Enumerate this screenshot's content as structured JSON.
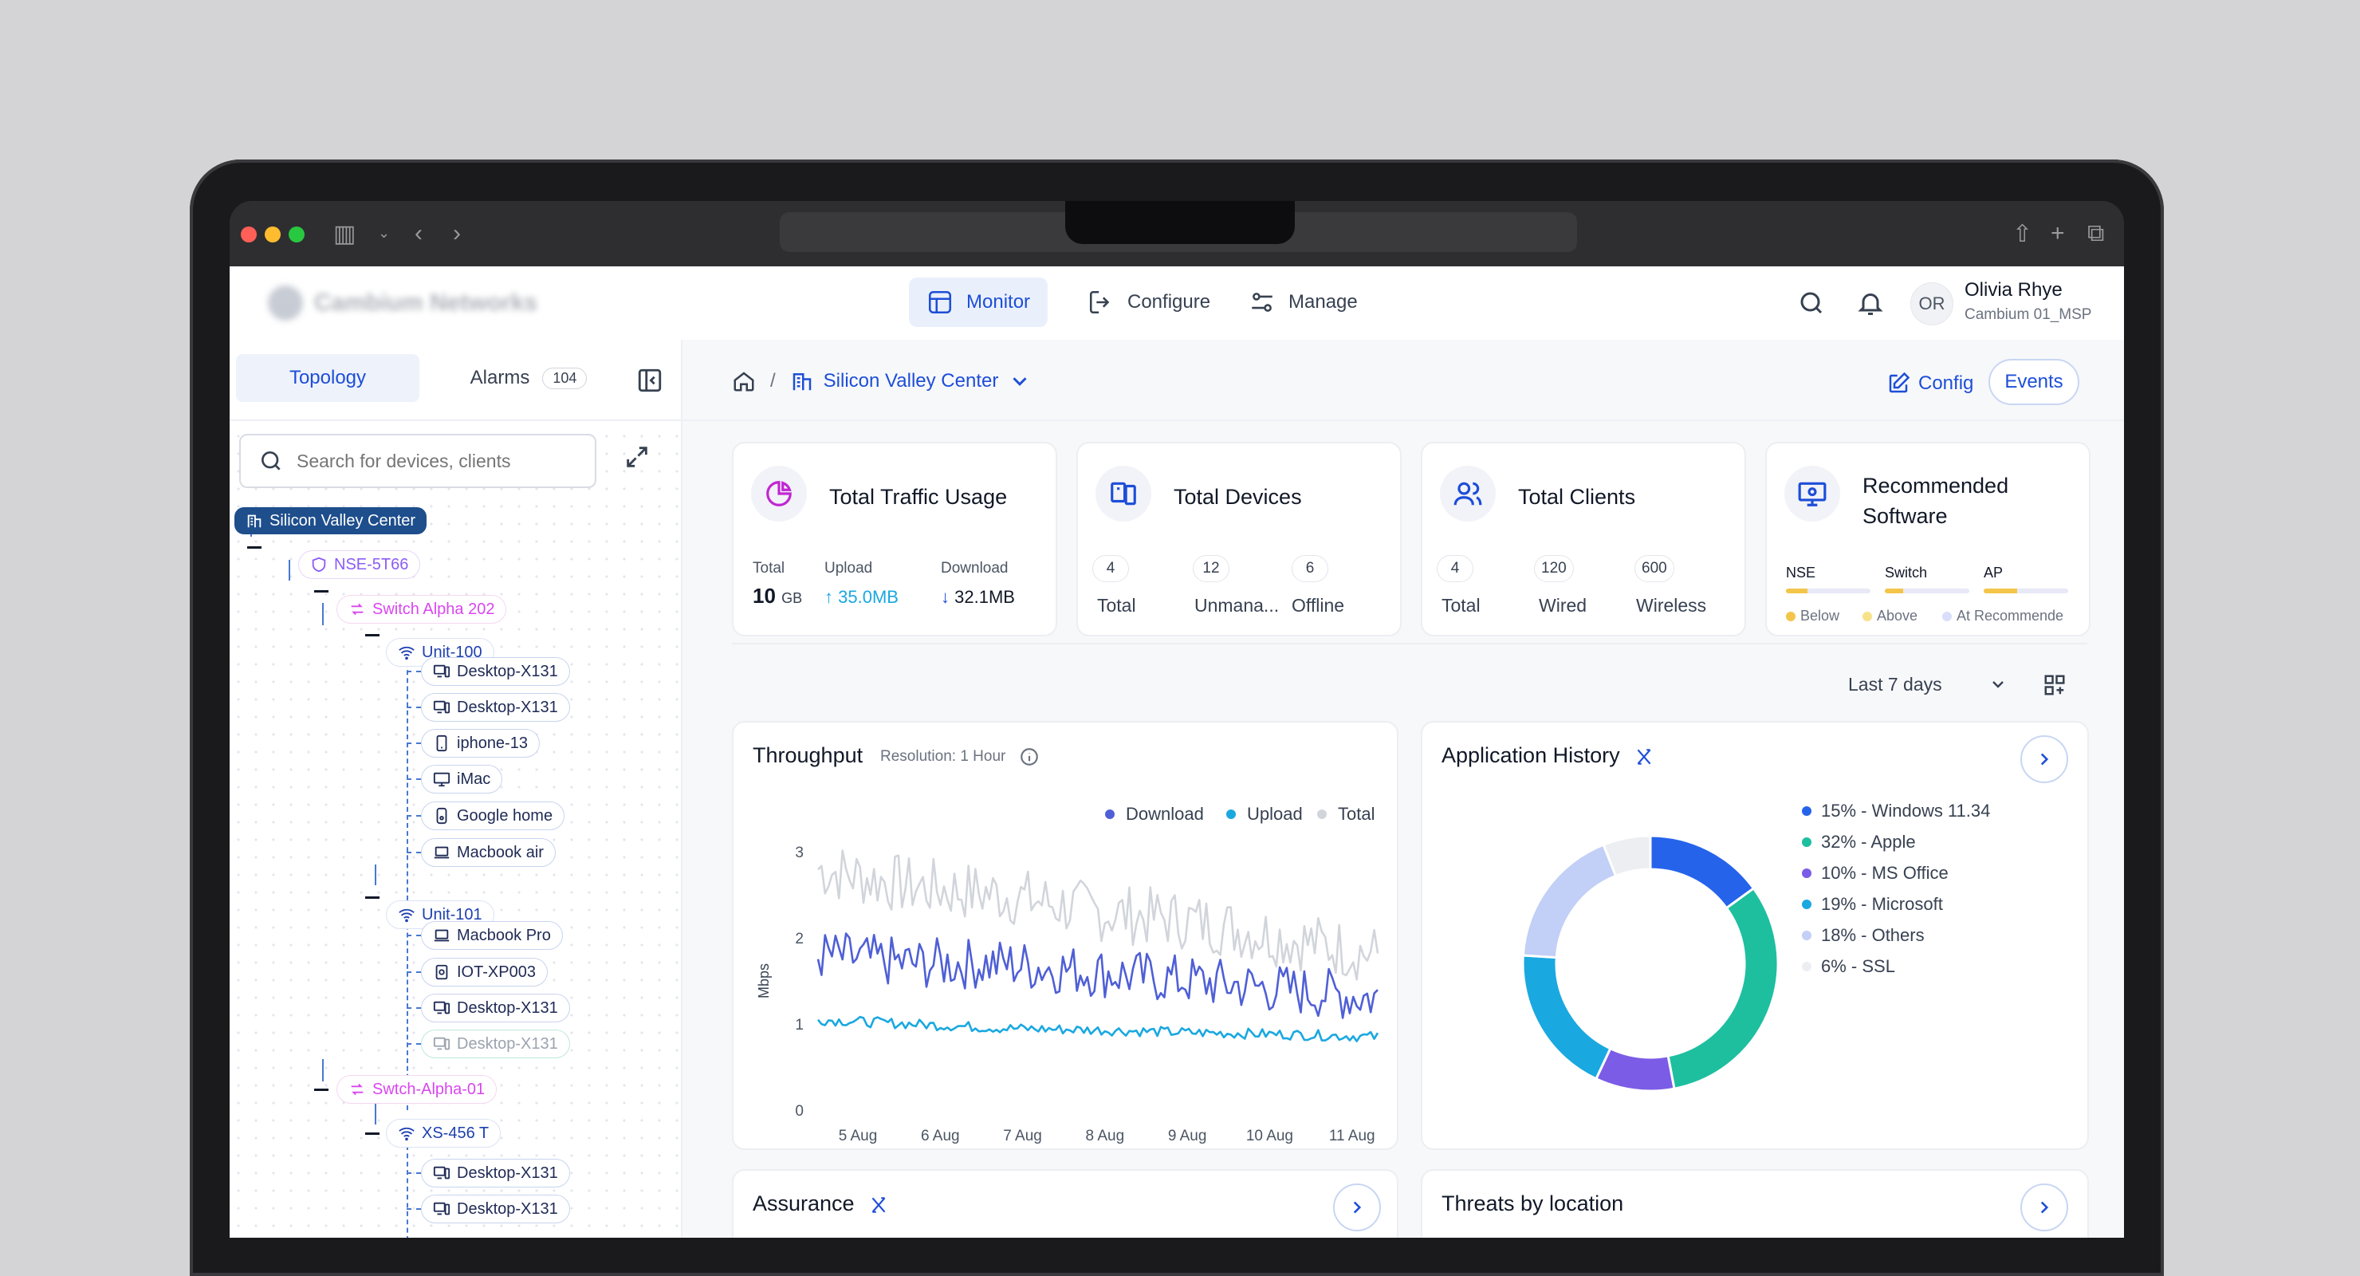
{
  "header": {
    "brand": "Cambium Networks",
    "nav": [
      {
        "label": "Monitor",
        "active": true
      },
      {
        "label": "Configure",
        "active": false
      },
      {
        "label": "Manage",
        "active": false
      }
    ],
    "user": {
      "initials": "OR",
      "name": "Olivia Rhye",
      "org": "Cambium 01_MSP"
    }
  },
  "sidebar": {
    "tabs": {
      "topology": "Topology",
      "alarms": "Alarms",
      "alarms_count": "104"
    },
    "search_placeholder": "Search for devices, clients",
    "tree": {
      "root": "Silicon Valley Center",
      "nse": "NSE-5T66",
      "switch1": "Switch Alpha 202",
      "unit100": "Unit-100",
      "unit100_devices": [
        "Desktop-X131",
        "Desktop-X131",
        "iphone-13",
        "iMac",
        "Google home",
        "Macbook air"
      ],
      "unit101": "Unit-101",
      "unit101_devices": [
        "Macbook Pro",
        "IOT-XP003",
        "Desktop-X131",
        "Desktop-X131"
      ],
      "switch2": "Swtch-Alpha-01",
      "xs": "XS-456 T",
      "xs_devices": [
        "Desktop-X131",
        "Desktop-X131"
      ]
    }
  },
  "main": {
    "breadcrumb_site": "Silicon Valley Center",
    "config_label": "Config",
    "events_label": "Events",
    "range_label": "Last 7 days",
    "kpis": {
      "traffic": {
        "title": "Total Traffic Usage",
        "total_label": "Total",
        "total_value": "10",
        "total_unit": "GB",
        "upload_label": "Upload",
        "upload_value": "35.0MB",
        "download_label": "Download",
        "download_value": "32.1MB"
      },
      "devices": {
        "title": "Total Devices",
        "total": "4",
        "total_label": "Total",
        "unmanaged": "12",
        "unmanaged_label": "Unmana...",
        "offline": "6",
        "offline_label": "Offline"
      },
      "clients": {
        "title": "Total Clients",
        "total": "4",
        "total_label": "Total",
        "wired": "120",
        "wired_label": "Wired",
        "wireless": "600",
        "wireless_label": "Wireless"
      },
      "software": {
        "title_line1": "Recommended",
        "title_line2": "Software",
        "items": [
          {
            "label": "NSE",
            "fill": 0.25
          },
          {
            "label": "Switch",
            "fill": 0.22
          },
          {
            "label": "AP",
            "fill": 0.4
          }
        ],
        "legend": [
          "Below",
          "Above",
          "At Recommende"
        ]
      }
    },
    "throughput": {
      "title": "Throughput",
      "resolution": "Resolution: 1 Hour",
      "legend": [
        "Download",
        "Upload",
        "Total"
      ],
      "ylabel": "Mbps"
    },
    "app_history": {
      "title": "Application History"
    },
    "assurance": {
      "title": "Assurance"
    },
    "threats": {
      "title": "Threats by location"
    }
  },
  "colors": {
    "accent": "#1d4ed8",
    "download": "#4f5fd6",
    "upload": "#1aa8e0",
    "total": "#d1d5db"
  },
  "chart_data": [
    {
      "type": "line",
      "title": "Throughput",
      "ylabel": "Mbps",
      "xlabel": "",
      "x": [
        "5 Aug",
        "6 Aug",
        "7 Aug",
        "8 Aug",
        "9 Aug",
        "10 Aug",
        "11 Aug"
      ],
      "ylim": [
        0,
        3
      ],
      "yticks": [
        0,
        1,
        2,
        3
      ],
      "legend_position": "top-right",
      "series": [
        {
          "name": "Download",
          "color": "#4f5fd6",
          "values": [
            1.8,
            1.7,
            1.7,
            1.6,
            1.5,
            1.4,
            1.3
          ]
        },
        {
          "name": "Upload",
          "color": "#1aa8e0",
          "values": [
            1.05,
            1.0,
            0.95,
            0.93,
            0.9,
            0.88,
            0.85
          ]
        },
        {
          "name": "Total",
          "color": "#d1d5db",
          "values": [
            2.8,
            2.6,
            2.5,
            2.3,
            2.2,
            2.0,
            1.8
          ]
        }
      ]
    },
    {
      "type": "pie",
      "title": "Application History",
      "slices": [
        {
          "label": "15% - Windows 11.34",
          "value": 15,
          "color": "#2563eb"
        },
        {
          "label": "32% - Apple",
          "value": 32,
          "color": "#1dbf9f"
        },
        {
          "label": "10% - MS Office",
          "value": 10,
          "color": "#7b5ce6"
        },
        {
          "label": "19% - Microsoft",
          "value": 19,
          "color": "#1aa8e0"
        },
        {
          "label": "18% - Others",
          "value": 18,
          "color": "#c2cff6"
        },
        {
          "label": "6% - SSL",
          "value": 6,
          "color": "#eceef2"
        }
      ]
    }
  ]
}
